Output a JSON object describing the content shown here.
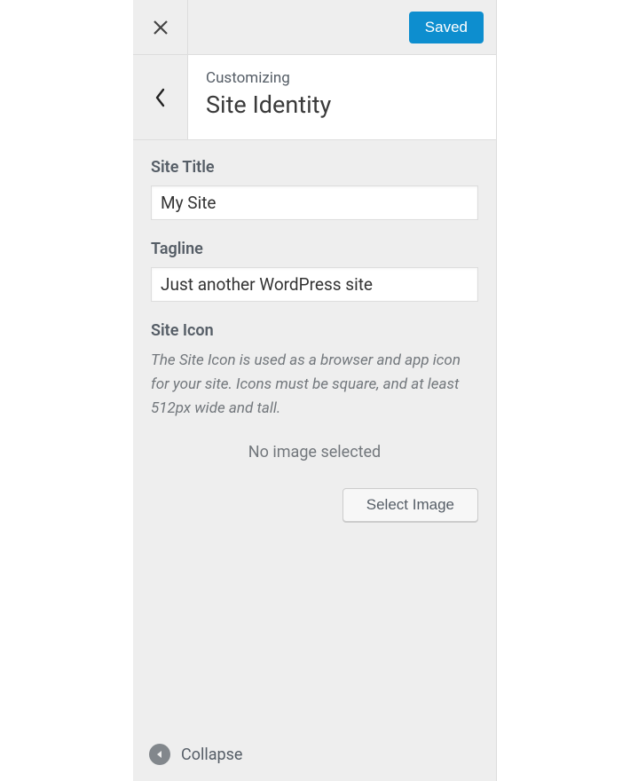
{
  "topbar": {
    "saved_label": "Saved"
  },
  "header": {
    "sup": "Customizing",
    "title": "Site Identity"
  },
  "fields": {
    "site_title_label": "Site Title",
    "site_title_value": "My Site",
    "tagline_label": "Tagline",
    "tagline_value": "Just another WordPress site",
    "site_icon_label": "Site Icon",
    "site_icon_desc": "The Site Icon is used as a browser and app icon for your site. Icons must be square, and at least 512px wide and tall.",
    "no_image_text": "No image selected",
    "select_image_label": "Select Image"
  },
  "footer": {
    "collapse_label": "Collapse"
  }
}
